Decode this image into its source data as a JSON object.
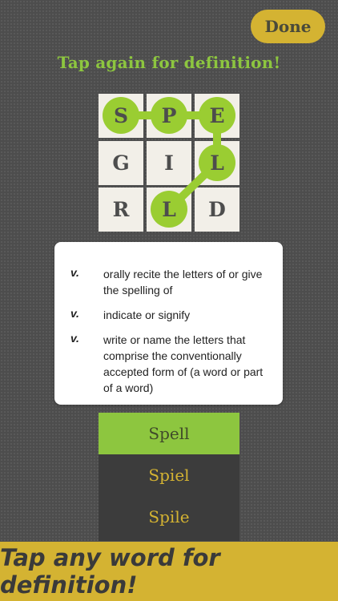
{
  "header": {
    "done_label": "Done"
  },
  "instruction": "Tap again for definition!",
  "grid": {
    "rows": [
      [
        "S",
        "P",
        "E"
      ],
      [
        "G",
        "I",
        "L"
      ],
      [
        "R",
        "L",
        "D"
      ]
    ],
    "selected_path": [
      [
        0,
        0
      ],
      [
        0,
        1
      ],
      [
        0,
        2
      ],
      [
        1,
        2
      ],
      [
        2,
        1
      ]
    ]
  },
  "definitions": [
    {
      "pos": "v.",
      "text": "orally recite the letters of or give the spelling of"
    },
    {
      "pos": "v.",
      "text": "indicate or signify"
    },
    {
      "pos": "v.",
      "text": "write or name the letters that comprise the conventionally accepted form of (a word or part of a word)"
    }
  ],
  "words": [
    {
      "label": "Spell",
      "selected": true
    },
    {
      "label": "Spiel",
      "selected": false
    },
    {
      "label": "Spile",
      "selected": false
    }
  ],
  "banner": "Tap any word for definition!",
  "colors": {
    "accent_green": "#8dc63f",
    "accent_gold": "#d4b332",
    "background": "#4d4d4d"
  }
}
